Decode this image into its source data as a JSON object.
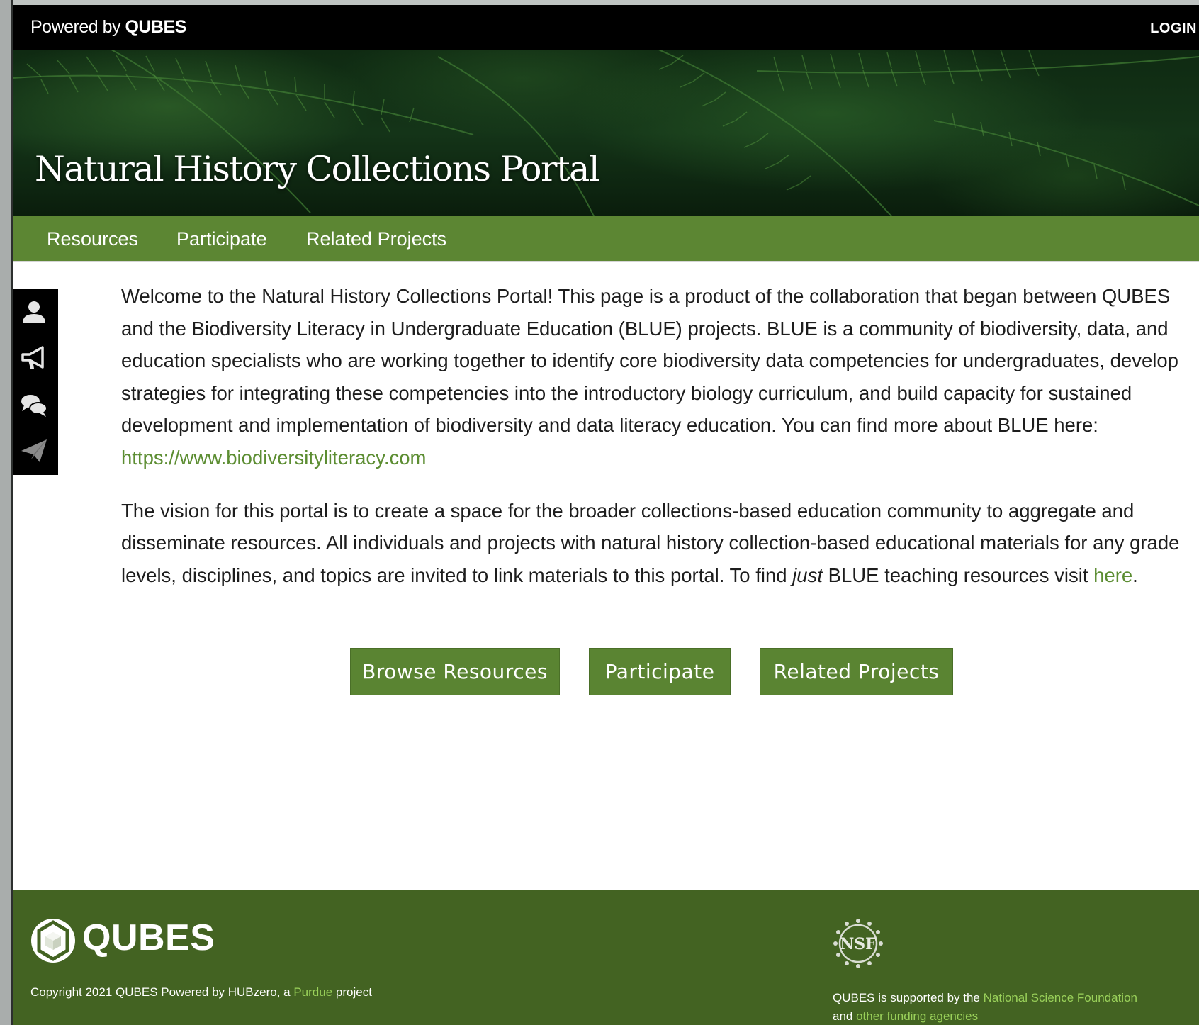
{
  "topbar": {
    "powered_prefix": "Powered by",
    "powered_brand": "QUBES",
    "login": "LOGIN"
  },
  "hero": {
    "title": "Natural History Collections Portal"
  },
  "nav": {
    "items": [
      {
        "label": "Resources"
      },
      {
        "label": "Participate"
      },
      {
        "label": "Related Projects"
      }
    ]
  },
  "sidebar_tools": [
    {
      "icon": "user-icon"
    },
    {
      "icon": "megaphone-icon"
    },
    {
      "icon": "chat-bubbles-icon"
    },
    {
      "icon": "paper-plane-icon"
    }
  ],
  "content": {
    "para1_text": "Welcome to the Natural History Collections Portal! This page is a product of the collaboration that began between QUBES and the Biodiversity Literacy in Undergraduate Education (BLUE) projects. BLUE is a community of biodiversity, data, and education specialists who are working together to identify core biodiversity data competencies for undergraduates, develop strategies for integrating these competencies into the introductory biology curriculum, and build capacity for sustained development and implementation of biodiversity and data literacy education. You can find more about BLUE here: ",
    "para1_link": "https://www.biodiversityliteracy.com",
    "para2_text_a": "The vision for this portal is to create a space for the broader collections-based education community to aggregate and disseminate resources. All individuals and projects with natural history collection-based educational materials for any grade levels, disciplines, and topics are invited to link materials to this portal. To find ",
    "para2_em": "just",
    "para2_text_b": " BLUE teaching resources visit ",
    "para2_link": "here",
    "para2_end": "."
  },
  "buttons": {
    "browse": "Browse Resources",
    "participate": "Participate",
    "related": "Related Projects"
  },
  "footer": {
    "brand": "QUBES",
    "copyright_a": "Copyright 2021 QUBES Powered by HUBzero, a ",
    "copyright_link": "Purdue",
    "copyright_b": " project",
    "nsf_label": "NSF",
    "support_a": "QUBES is supported by the ",
    "support_link1": "National Science Foundation",
    "support_b": "and ",
    "support_link2": "other funding agencies"
  },
  "colors": {
    "nav_green": "#5c8633",
    "footer_green": "#436322",
    "link_green": "#5c8d32",
    "footer_link": "#9ad15a"
  }
}
